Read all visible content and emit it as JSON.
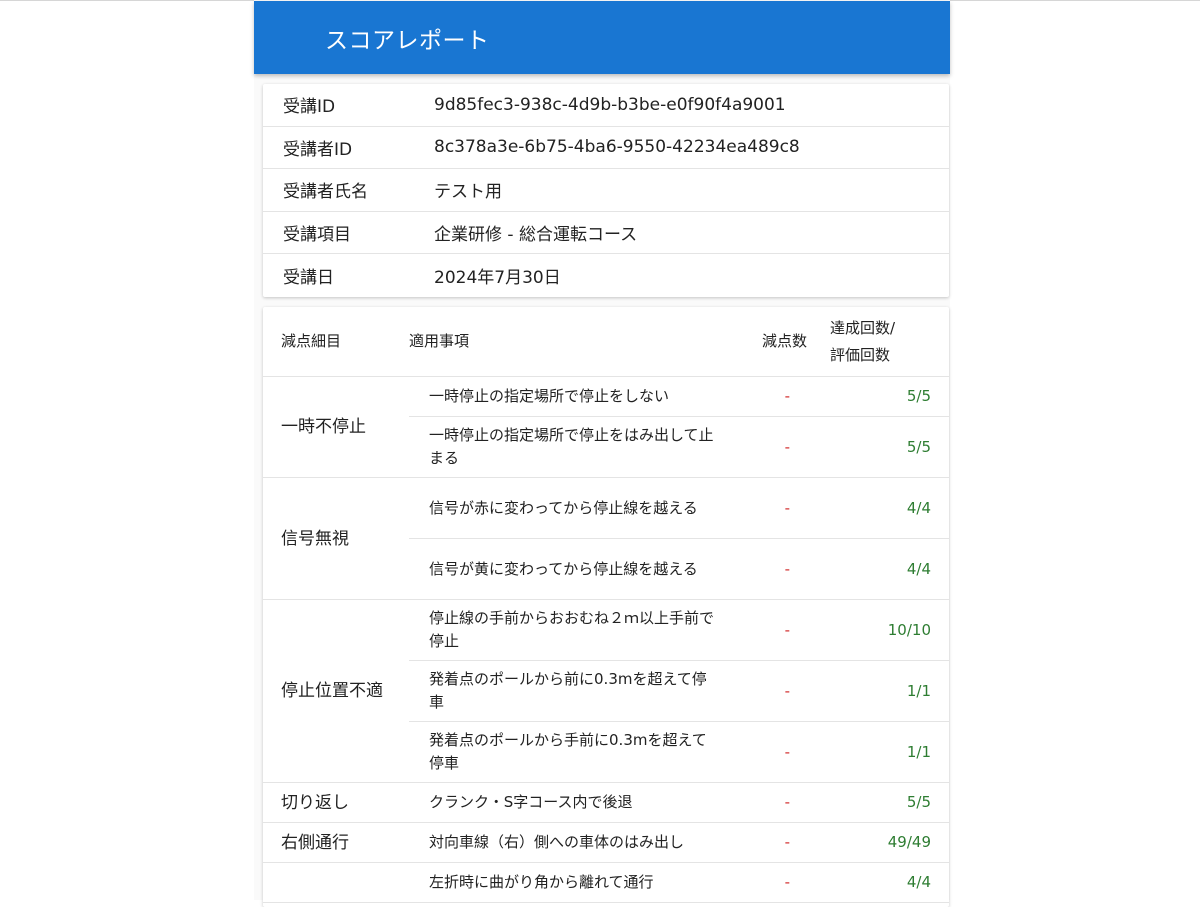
{
  "colors": {
    "appbar": "#1976d2",
    "deduction": "#d32f2f",
    "achievement": "#2e7d32"
  },
  "appbar": {
    "title": "スコアレポート"
  },
  "info": {
    "rows": [
      {
        "label": "受講ID",
        "value": "9d85fec3-938c-4d9b-b3be-e0f90f4a9001"
      },
      {
        "label": "受講者ID",
        "value": "8c378a3e-6b75-4ba6-9550-42234ea489c8"
      },
      {
        "label": "受講者氏名",
        "value": "テスト用"
      },
      {
        "label": "受講項目",
        "value": "企業研修 - 総合運転コース"
      },
      {
        "label": "受講日",
        "value": "2024年7月30日"
      }
    ]
  },
  "score": {
    "headers": {
      "detail": "減点細目",
      "item": "適用事項",
      "deduction": "減点数",
      "achievement_line1": "達成回数/",
      "achievement_line2": "評価回数"
    },
    "groups": [
      {
        "name": "一時不停止",
        "rows": [
          {
            "item": "一時停止の指定場所で停止をしない",
            "deduction": "-",
            "achievement": "5/5"
          },
          {
            "item": "一時停止の指定場所で停止をはみ出して止まる",
            "deduction": "-",
            "achievement": "5/5"
          }
        ]
      },
      {
        "name": "信号無視",
        "rows": [
          {
            "item": "信号が赤に変わってから停止線を越える",
            "deduction": "-",
            "achievement": "4/4"
          },
          {
            "item": "信号が黄に変わってから停止線を越える",
            "deduction": "-",
            "achievement": "4/4"
          }
        ]
      },
      {
        "name": "停止位置不適",
        "rows": [
          {
            "item": "停止線の手前からおおむね２ｍ以上手前で停止",
            "deduction": "-",
            "achievement": "10/10"
          },
          {
            "item": "発着点のポールから前に0.3mを超えて停車",
            "deduction": "-",
            "achievement": "1/1"
          },
          {
            "item": "発着点のポールから手前に0.3mを超えて停車",
            "deduction": "-",
            "achievement": "1/1"
          }
        ]
      },
      {
        "name": "切り返し",
        "rows": [
          {
            "item": "クランク・S字コース内で後退",
            "deduction": "-",
            "achievement": "5/5"
          }
        ]
      },
      {
        "name": "右側通行",
        "rows": [
          {
            "item": "対向車線（右）側への車体のはみ出し",
            "deduction": "-",
            "achievement": "49/49"
          }
        ]
      },
      {
        "name": "",
        "rows": [
          {
            "item": "左折時に曲がり角から離れて通行",
            "deduction": "-",
            "achievement": "4/4"
          }
        ]
      }
    ]
  }
}
